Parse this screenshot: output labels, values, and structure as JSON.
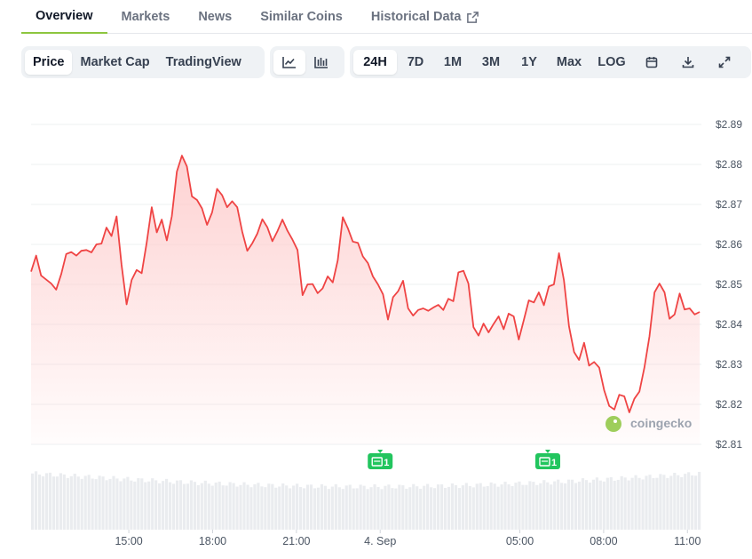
{
  "tabs": [
    {
      "label": "Overview",
      "active": true
    },
    {
      "label": "Markets"
    },
    {
      "label": "News"
    },
    {
      "label": "Similar Coins"
    },
    {
      "label": "Historical Data",
      "external": true
    }
  ],
  "toolbar": {
    "metric_buttons": [
      "Price",
      "Market Cap",
      "TradingView"
    ],
    "chart_type_icons": [
      "line-chart-icon",
      "candlestick-chart-icon"
    ],
    "range_buttons": [
      "24H",
      "7D",
      "1M",
      "3M",
      "1Y",
      "Max",
      "LOG"
    ],
    "action_icons": [
      "calendar-icon",
      "download-icon",
      "fullscreen-icon"
    ],
    "active_metric": "Price",
    "active_range": "24H"
  },
  "watermark": "coingecko",
  "colors": {
    "line": "#ef4444",
    "area_top": "#fecaca",
    "volume": "#e5e7eb",
    "accent": "#8dc63f",
    "event_badge": "#22c55e"
  },
  "chart_data": {
    "type": "line",
    "y_ticks": [
      "$2.89",
      "$2.88",
      "$2.87",
      "$2.86",
      "$2.85",
      "$2.84",
      "$2.83",
      "$2.82",
      "$2.81"
    ],
    "ylim": [
      2.81,
      2.89
    ],
    "x_ticks": [
      "15:00",
      "18:00",
      "21:00",
      "4. Sep",
      "05:00",
      "08:00",
      "11:00"
    ],
    "x_tick_hours": [
      15,
      18,
      21,
      24,
      29,
      32,
      35
    ],
    "x_range_hours": [
      11.5,
      35.5
    ],
    "events": [
      {
        "hour": 24,
        "label": "1"
      },
      {
        "hour": 30,
        "label": "1"
      }
    ],
    "series": [
      {
        "points": [
          [
            11.5,
            2.8532
          ],
          [
            11.68,
            2.8572
          ],
          [
            11.86,
            2.8522
          ],
          [
            12.04,
            2.8512
          ],
          [
            12.22,
            2.8502
          ],
          [
            12.4,
            2.8487
          ],
          [
            12.58,
            2.8526
          ],
          [
            12.76,
            2.8576
          ],
          [
            12.94,
            2.8581
          ],
          [
            13.12,
            2.8572
          ],
          [
            13.3,
            2.8584
          ],
          [
            13.48,
            2.8586
          ],
          [
            13.66,
            2.858
          ],
          [
            13.84,
            2.86
          ],
          [
            14.02,
            2.8602
          ],
          [
            14.2,
            2.8642
          ],
          [
            14.38,
            2.8621
          ],
          [
            14.56,
            2.867
          ],
          [
            14.74,
            2.8549
          ],
          [
            14.92,
            2.845
          ],
          [
            15.1,
            2.8511
          ],
          [
            15.28,
            2.8536
          ],
          [
            15.46,
            2.8528
          ],
          [
            15.64,
            2.8604
          ],
          [
            15.82,
            2.8693
          ],
          [
            16.0,
            2.863
          ],
          [
            16.18,
            2.8662
          ],
          [
            16.36,
            2.861
          ],
          [
            16.54,
            2.867
          ],
          [
            16.72,
            2.8782
          ],
          [
            16.9,
            2.8822
          ],
          [
            17.08,
            2.8795
          ],
          [
            17.26,
            2.872
          ],
          [
            17.44,
            2.8711
          ],
          [
            17.62,
            2.869
          ],
          [
            17.8,
            2.8649
          ],
          [
            17.98,
            2.868
          ],
          [
            18.16,
            2.8739
          ],
          [
            18.34,
            2.8723
          ],
          [
            18.52,
            2.8693
          ],
          [
            18.7,
            2.8708
          ],
          [
            18.88,
            2.8693
          ],
          [
            19.06,
            2.8632
          ],
          [
            19.24,
            2.8584
          ],
          [
            19.42,
            2.8603
          ],
          [
            19.6,
            2.8627
          ],
          [
            19.78,
            2.8663
          ],
          [
            19.96,
            2.8643
          ],
          [
            20.14,
            2.8608
          ],
          [
            20.32,
            2.8633
          ],
          [
            20.5,
            2.8662
          ],
          [
            20.68,
            2.8634
          ],
          [
            20.86,
            2.8612
          ],
          [
            21.04,
            2.8586
          ],
          [
            21.22,
            2.8473
          ],
          [
            21.4,
            2.85
          ],
          [
            21.58,
            2.8501
          ],
          [
            21.76,
            2.8478
          ],
          [
            21.94,
            2.849
          ],
          [
            22.12,
            2.852
          ],
          [
            22.3,
            2.8505
          ],
          [
            22.48,
            2.856
          ],
          [
            22.66,
            2.8668
          ],
          [
            22.84,
            2.8641
          ],
          [
            23.02,
            2.8607
          ],
          [
            23.2,
            2.8604
          ],
          [
            23.38,
            2.857
          ],
          [
            23.56,
            2.8553
          ],
          [
            23.74,
            2.852
          ],
          [
            23.92,
            2.85
          ],
          [
            24.1,
            2.8475
          ],
          [
            24.28,
            2.8412
          ],
          [
            24.46,
            2.8468
          ],
          [
            24.64,
            2.8483
          ],
          [
            24.82,
            2.8509
          ],
          [
            25.0,
            2.844
          ],
          [
            25.18,
            2.8422
          ],
          [
            25.36,
            2.8436
          ],
          [
            25.54,
            2.844
          ],
          [
            25.72,
            2.8434
          ],
          [
            25.9,
            2.8442
          ],
          [
            26.08,
            2.8449
          ],
          [
            26.26,
            2.8436
          ],
          [
            26.44,
            2.8464
          ],
          [
            26.62,
            2.8458
          ],
          [
            26.8,
            2.853
          ],
          [
            26.98,
            2.8534
          ],
          [
            27.16,
            2.8502
          ],
          [
            27.34,
            2.8393
          ],
          [
            27.52,
            2.8372
          ],
          [
            27.7,
            2.8402
          ],
          [
            27.88,
            2.838
          ],
          [
            28.06,
            2.8401
          ],
          [
            28.24,
            2.842
          ],
          [
            28.42,
            2.8388
          ],
          [
            28.6,
            2.8427
          ],
          [
            28.78,
            2.842
          ],
          [
            28.96,
            2.8362
          ],
          [
            29.14,
            2.841
          ],
          [
            29.32,
            2.846
          ],
          [
            29.5,
            2.8455
          ],
          [
            29.68,
            2.848
          ],
          [
            29.86,
            2.8448
          ],
          [
            30.04,
            2.8495
          ],
          [
            30.22,
            2.85
          ],
          [
            30.4,
            2.8578
          ],
          [
            30.58,
            2.851
          ],
          [
            30.76,
            2.8395
          ],
          [
            30.94,
            2.8331
          ],
          [
            31.12,
            2.8311
          ],
          [
            31.3,
            2.8354
          ],
          [
            31.48,
            2.8297
          ],
          [
            31.66,
            2.8306
          ],
          [
            31.84,
            2.8292
          ],
          [
            32.02,
            2.8235
          ],
          [
            32.2,
            2.8196
          ],
          [
            32.38,
            2.8187
          ],
          [
            32.56,
            2.8224
          ],
          [
            32.74,
            2.822
          ],
          [
            32.92,
            2.818
          ],
          [
            33.1,
            2.8214
          ],
          [
            33.28,
            2.8232
          ],
          [
            33.46,
            2.8292
          ],
          [
            33.64,
            2.837
          ],
          [
            33.82,
            2.848
          ],
          [
            34.0,
            2.8502
          ],
          [
            34.18,
            2.848
          ],
          [
            34.36,
            2.8414
          ],
          [
            34.54,
            2.8425
          ],
          [
            34.72,
            2.8477
          ],
          [
            34.9,
            2.8437
          ],
          [
            35.08,
            2.844
          ],
          [
            35.26,
            2.8425
          ],
          [
            35.44,
            2.8431
          ]
        ]
      }
    ]
  }
}
